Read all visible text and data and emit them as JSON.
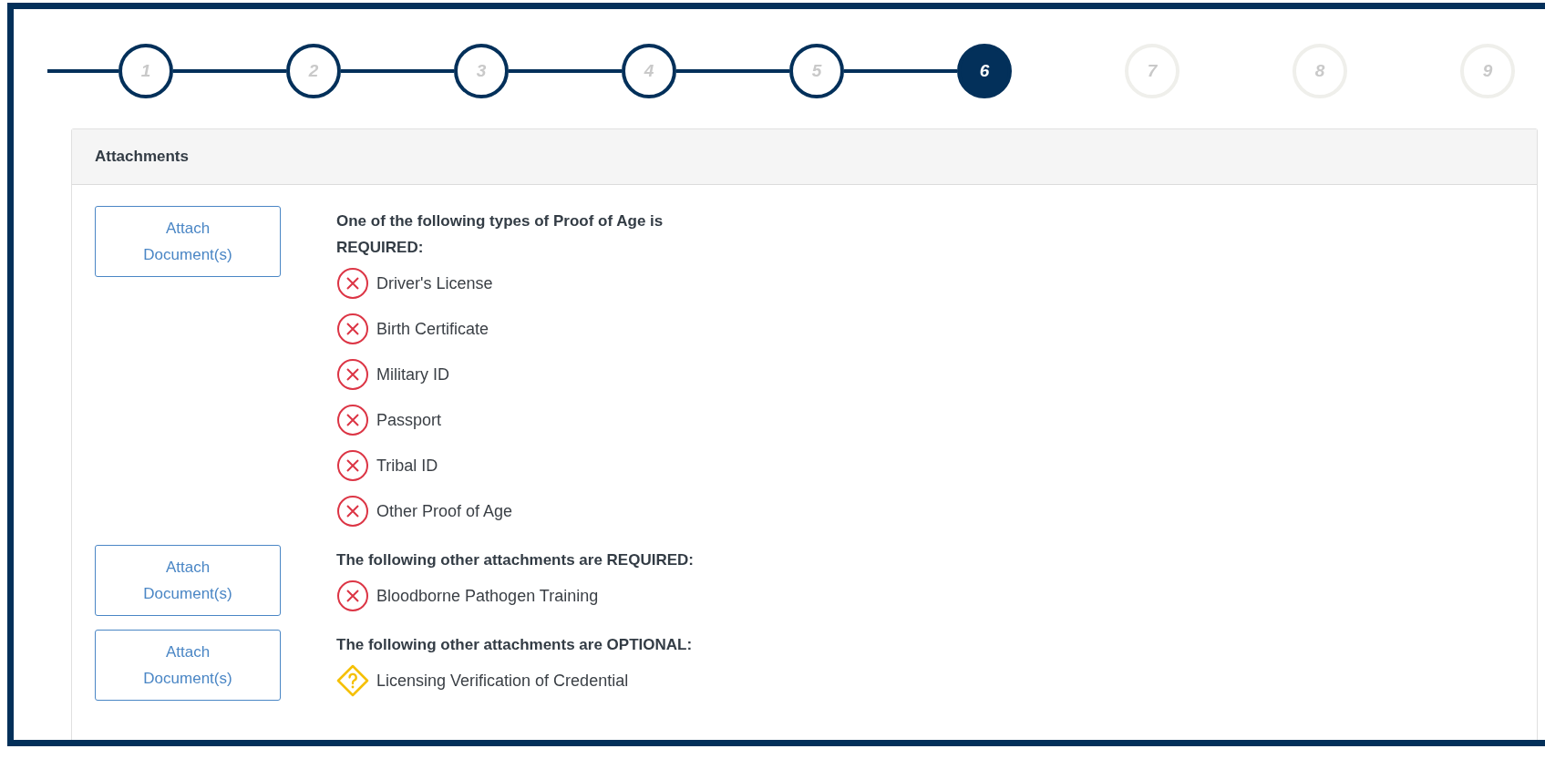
{
  "stepper": {
    "steps": [
      {
        "label": "1",
        "completed": true,
        "selected": false
      },
      {
        "label": "2",
        "completed": true,
        "selected": false
      },
      {
        "label": "3",
        "completed": true,
        "selected": false
      },
      {
        "label": "4",
        "completed": true,
        "selected": false
      },
      {
        "label": "5",
        "completed": true,
        "selected": false
      },
      {
        "label": "6",
        "completed": false,
        "selected": true
      },
      {
        "label": "7",
        "completed": false,
        "selected": false
      },
      {
        "label": "8",
        "completed": false,
        "selected": false
      },
      {
        "label": "9",
        "completed": false,
        "selected": false
      }
    ]
  },
  "panel": {
    "title": "Attachments",
    "sections": [
      {
        "button": "Attach Document(s)",
        "heading": "One of the following types of Proof of Age is REQUIRED:",
        "items": [
          {
            "label": "Driver's License",
            "kind": "missing"
          },
          {
            "label": "Birth Certificate",
            "kind": "missing"
          },
          {
            "label": "Military ID",
            "kind": "missing"
          },
          {
            "label": "Passport",
            "kind": "missing"
          },
          {
            "label": "Tribal ID",
            "kind": "missing"
          },
          {
            "label": "Other Proof of Age",
            "kind": "missing"
          }
        ]
      },
      {
        "button": "Attach Document(s)",
        "heading": "The following other attachments are REQUIRED:",
        "items": [
          {
            "label": "Bloodborne Pathogen Training",
            "kind": "missing"
          }
        ]
      },
      {
        "button": "Attach Document(s)",
        "heading": "The following other attachments are OPTIONAL:",
        "items": [
          {
            "label": "Licensing Verification of Credential",
            "kind": "optional"
          }
        ]
      }
    ]
  }
}
